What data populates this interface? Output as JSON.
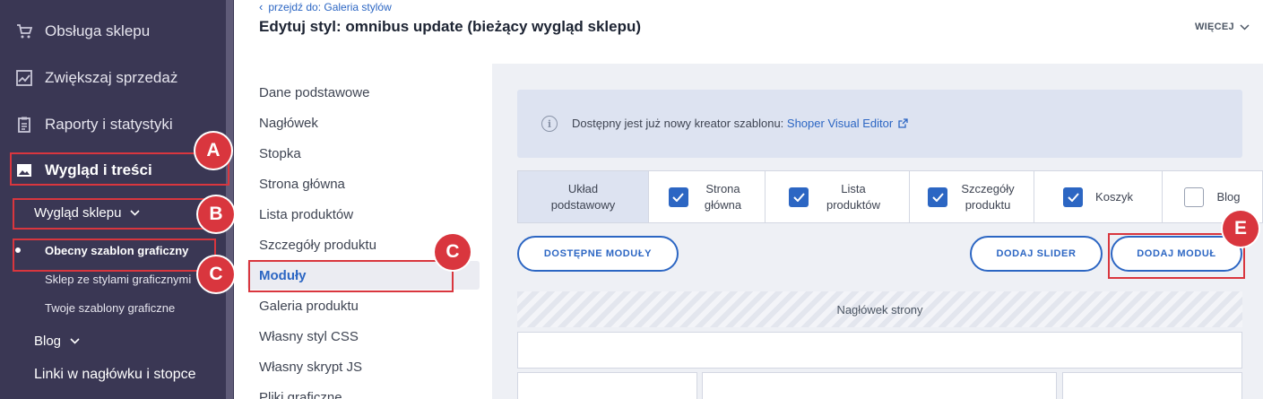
{
  "sidebar": {
    "items": [
      {
        "label": "Obsługa sklepu",
        "icon": "cart-icon"
      },
      {
        "label": "Zwiększaj sprzedaż",
        "icon": "chart-icon"
      },
      {
        "label": "Raporty i statystyki",
        "icon": "clipboard-icon"
      },
      {
        "label": "Wygląd i treści",
        "icon": "image-icon"
      }
    ],
    "submenu": {
      "label": "Wygląd sklepu",
      "items": [
        {
          "label": "Obecny szablon graficzny"
        },
        {
          "label": "Sklep ze stylami graficznymi"
        },
        {
          "label": "Twoje szablony graficzne"
        }
      ]
    },
    "blog_label": "Blog",
    "links_label": "Linki w nagłówku i stopce"
  },
  "header": {
    "back_link": "przejdź do: Galeria stylów",
    "title": "Edytuj styl: omnibus update (bieżący wygląd sklepu)",
    "more_label": "WIĘCEJ"
  },
  "menu": {
    "items": [
      {
        "label": "Dane podstawowe"
      },
      {
        "label": "Nagłówek"
      },
      {
        "label": "Stopka"
      },
      {
        "label": "Strona główna"
      },
      {
        "label": "Lista produktów"
      },
      {
        "label": "Szczegóły produktu"
      },
      {
        "label": "Moduły"
      },
      {
        "label": "Galeria produktu"
      },
      {
        "label": "Własny styl CSS"
      },
      {
        "label": "Własny skrypt JS"
      },
      {
        "label": "Pliki graficzne"
      }
    ]
  },
  "info": {
    "text": "Dostępny jest już nowy kreator szablonu: ",
    "link": "Shoper Visual Editor"
  },
  "tabs": [
    {
      "label": "Układ podstawowy",
      "checked": null
    },
    {
      "label": "Strona główna",
      "checked": true
    },
    {
      "label": "Lista produktów",
      "checked": true
    },
    {
      "label": "Szczegóły produktu",
      "checked": true
    },
    {
      "label": "Koszyk",
      "checked": true
    },
    {
      "label": "Blog",
      "checked": false
    }
  ],
  "buttons": {
    "available_modules": "DOSTĘPNE MODUŁY",
    "add_slider": "DODAJ SLIDER",
    "add_module": "DODAJ MODUŁ"
  },
  "layout": {
    "header_area": "Nagłówek strony"
  },
  "annotations": {
    "A": "A",
    "B": "B",
    "C": "C",
    "E": "E"
  },
  "colors": {
    "sidebar_bg": "#3a3754",
    "accent": "#2c66c3",
    "annotation_red": "#d9363e"
  }
}
